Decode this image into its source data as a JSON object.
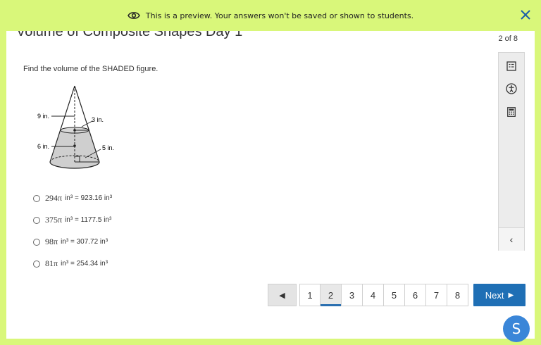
{
  "banner": {
    "text": "This is a preview. Your answers won't be saved or shown to students.",
    "icon": "eye-icon",
    "close_icon": "close-icon"
  },
  "header": {
    "title": "Volume of Composite Shapes Day 1",
    "progress": "2 of 8"
  },
  "question": {
    "prompt": "Find the volume of the SHADED figure.",
    "figure_labels": {
      "top_radius_label": "9 in.",
      "top_height_label": "3 in.",
      "bottom_radius_label": "6 in.",
      "bottom_height_label": "5 in."
    },
    "choices": [
      {
        "math": "294π",
        "text": " in³ = 923.16 in³"
      },
      {
        "math": "375π",
        "text": " in³ = 1177.5 in³"
      },
      {
        "math": "98π",
        "text": " in³ = 307.72 in³"
      },
      {
        "math": "81π",
        "text": " in³ = 254.34 in³"
      }
    ]
  },
  "sidebar": {
    "tools": [
      "reference-sheet-icon",
      "accessibility-icon",
      "calculator-icon"
    ],
    "collapse_label": "‹"
  },
  "pagination": {
    "prev_label": "◀",
    "pages": [
      "1",
      "2",
      "3",
      "4",
      "5",
      "6",
      "7",
      "8"
    ],
    "current": "2",
    "next_label": "Next",
    "next_icon": "▶"
  },
  "user": {
    "avatar_initial": "S",
    "avatar_color": "#3a86d8"
  },
  "colors": {
    "banner_bg": "#d9f77a",
    "primary": "#1f6fb5"
  }
}
